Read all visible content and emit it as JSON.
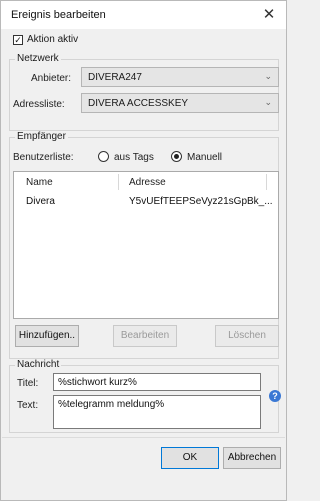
{
  "window": {
    "title": "Ereignis bearbeiten",
    "close_symbol": "✕"
  },
  "active_checkbox": {
    "label": "Aktion aktiv",
    "checked": true,
    "mark": "✓"
  },
  "network": {
    "legend": "Netzwerk",
    "provider_label": "Anbieter:",
    "provider_value": "DIVERA247",
    "address_list_label": "Adressliste:",
    "address_list_value": "DIVERA ACCESSKEY"
  },
  "recipients": {
    "legend": "Empfänger",
    "user_list_label": "Benutzerliste:",
    "radio_tags_label": "aus Tags",
    "radio_manual_label": "Manuell",
    "selected_mode": "manual",
    "columns": [
      "Name",
      "Adresse"
    ],
    "rows": [
      {
        "name": "Divera",
        "address": "Y5vUEfTEEPSeVyz21sGpBk_..."
      }
    ],
    "buttons": {
      "add": "Hinzufügen..",
      "edit": "Bearbeiten",
      "delete": "Löschen"
    }
  },
  "message": {
    "legend": "Nachricht",
    "title_label": "Titel:",
    "title_value": "%stichwort kurz%",
    "text_label": "Text:",
    "text_value": "%telegramm meldung%",
    "help_symbol": "?"
  },
  "footer": {
    "ok_label": "OK",
    "cancel_label": "Abbrechen"
  },
  "colors": {
    "accent": "#0078d7",
    "help_icon": "#3a78d4",
    "background": "#f0f0f0"
  }
}
